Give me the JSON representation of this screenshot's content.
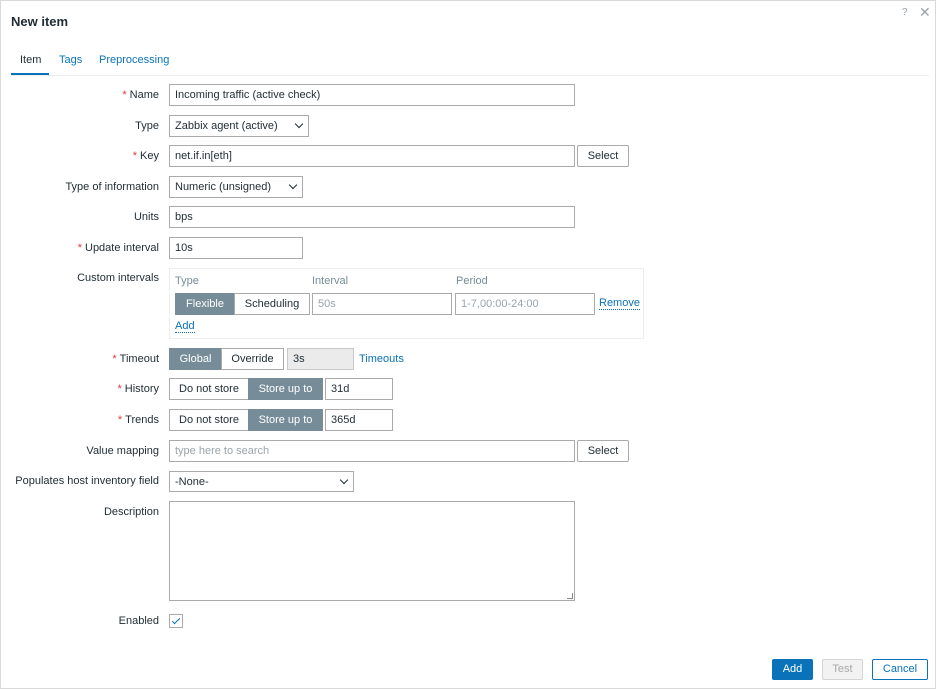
{
  "dialog": {
    "title": "New item",
    "help_symbol": "?",
    "close_symbol": "✕",
    "icons": {
      "help": "help-icon",
      "close": "close-icon"
    }
  },
  "tabs": [
    {
      "label": "Item",
      "active": true
    },
    {
      "label": "Tags",
      "active": false
    },
    {
      "label": "Preprocessing",
      "active": false
    }
  ],
  "form": {
    "required_marker": "*",
    "name": {
      "label": "Name",
      "value": "Incoming traffic (active check)"
    },
    "type": {
      "label": "Type",
      "value": "Zabbix agent (active)"
    },
    "key": {
      "label": "Key",
      "value": "net.if.in[eth]",
      "select_button": "Select"
    },
    "type_of_information": {
      "label": "Type of information",
      "value": "Numeric (unsigned)"
    },
    "units": {
      "label": "Units",
      "value": "bps"
    },
    "update_interval": {
      "label": "Update interval",
      "value": "10s"
    },
    "custom_intervals": {
      "label": "Custom intervals",
      "headers": {
        "type": "Type",
        "interval": "Interval",
        "period": "Period"
      },
      "row": {
        "type_options": [
          "Flexible",
          "Scheduling"
        ],
        "selected_type": "Flexible",
        "interval_placeholder": "50s",
        "period_placeholder": "1-7,00:00-24:00",
        "remove_label": "Remove"
      },
      "add_label": "Add"
    },
    "timeout": {
      "label": "Timeout",
      "options": [
        "Global",
        "Override"
      ],
      "selected": "Global",
      "value": "3s",
      "link": "Timeouts"
    },
    "history": {
      "label": "History",
      "options": [
        "Do not store",
        "Store up to"
      ],
      "selected": "Store up to",
      "value": "31d"
    },
    "trends": {
      "label": "Trends",
      "options": [
        "Do not store",
        "Store up to"
      ],
      "selected": "Store up to",
      "value": "365d"
    },
    "value_mapping": {
      "label": "Value mapping",
      "placeholder": "type here to search",
      "select_button": "Select"
    },
    "inventory_field": {
      "label": "Populates host inventory field",
      "value": "-None-"
    },
    "description": {
      "label": "Description",
      "value": ""
    },
    "enabled": {
      "label": "Enabled",
      "checked": true
    }
  },
  "footer": {
    "add_label": "Add",
    "test_label": "Test",
    "cancel_label": "Cancel"
  },
  "colors": {
    "accent": "#0a72b8",
    "required": "#e33734",
    "segment_active": "#768d99"
  }
}
